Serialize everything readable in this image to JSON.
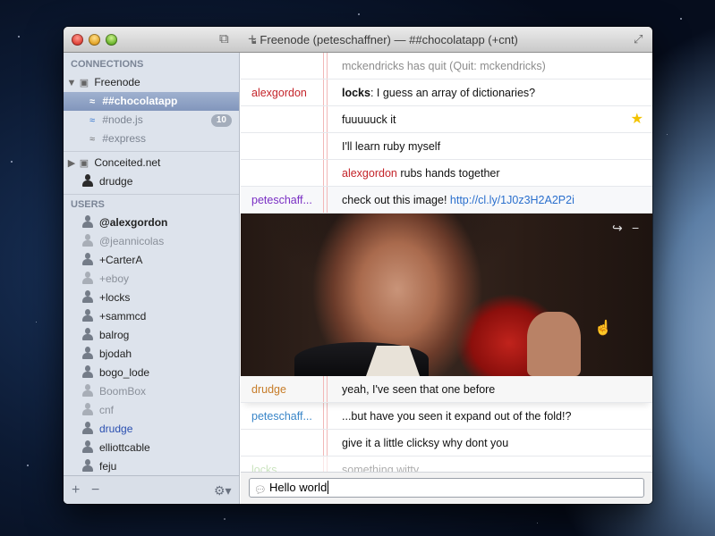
{
  "window": {
    "title": "Freenode (peteschaffner) — ##chocolatapp (+cnt)"
  },
  "sidebar": {
    "connections_header": "CONNECTIONS",
    "users_header": "USERS",
    "servers": [
      {
        "name": "Freenode",
        "channels": [
          {
            "name": "##chocolatapp",
            "selected": true
          },
          {
            "name": "#node.js",
            "badge": "10"
          },
          {
            "name": "#express"
          }
        ]
      },
      {
        "name": "Conceited.net"
      }
    ],
    "direct": "drudge",
    "users": [
      {
        "name": "@alexgordon",
        "style": "bold"
      },
      {
        "name": "@jeannicolas",
        "style": "muted"
      },
      {
        "name": "+CarterA",
        "style": "normal"
      },
      {
        "name": "+eboy",
        "style": "muted"
      },
      {
        "name": "+locks",
        "style": "normal"
      },
      {
        "name": "+sammcd",
        "style": "normal"
      },
      {
        "name": "balrog",
        "style": "normal"
      },
      {
        "name": "bjodah",
        "style": "normal"
      },
      {
        "name": "bogo_lode",
        "style": "normal"
      },
      {
        "name": "BoomBox",
        "style": "muted"
      },
      {
        "name": "cnf",
        "style": "muted"
      },
      {
        "name": "drudge",
        "style": "link"
      },
      {
        "name": "elliottcable",
        "style": "normal"
      },
      {
        "name": "feju",
        "style": "normal"
      }
    ]
  },
  "messages": [
    {
      "nick": "",
      "text": "mckendricks has quit (Quit: mckendricks)"
    },
    {
      "nick": "alexgordon",
      "mention": "locks",
      "text": ": I guess an array of dictionaries?"
    },
    {
      "nick": "",
      "text": "fuuuuuck it"
    },
    {
      "nick": "",
      "text": "I'll learn ruby myself"
    },
    {
      "nick": "",
      "actor": "alexgordon",
      "text": " rubs hands together"
    },
    {
      "nick": "peteschaff...",
      "text": "check out this image! ",
      "link": "http://cl.ly/1J0z3H2A2P2i"
    },
    {
      "nick": "drudge",
      "text": "yeah, I've seen that one before"
    },
    {
      "nick": "peteschaff...",
      "text": "...but have you seen it expand out of the fold!?"
    },
    {
      "nick": "",
      "text": "give it a little clicksy why dont you"
    },
    {
      "nick": "locks",
      "text": "something witty"
    }
  ],
  "input": {
    "value": "Hello world"
  },
  "colors": {
    "nick_alexgordon": "#c4242a",
    "nick_pete_purple": "#7a2fc4",
    "nick_drudge": "#c77d2a",
    "nick_pete_blue": "#3a86c8",
    "nick_locks": "#9acd79",
    "star": "#f3c300",
    "link": "#2a6fcd"
  }
}
